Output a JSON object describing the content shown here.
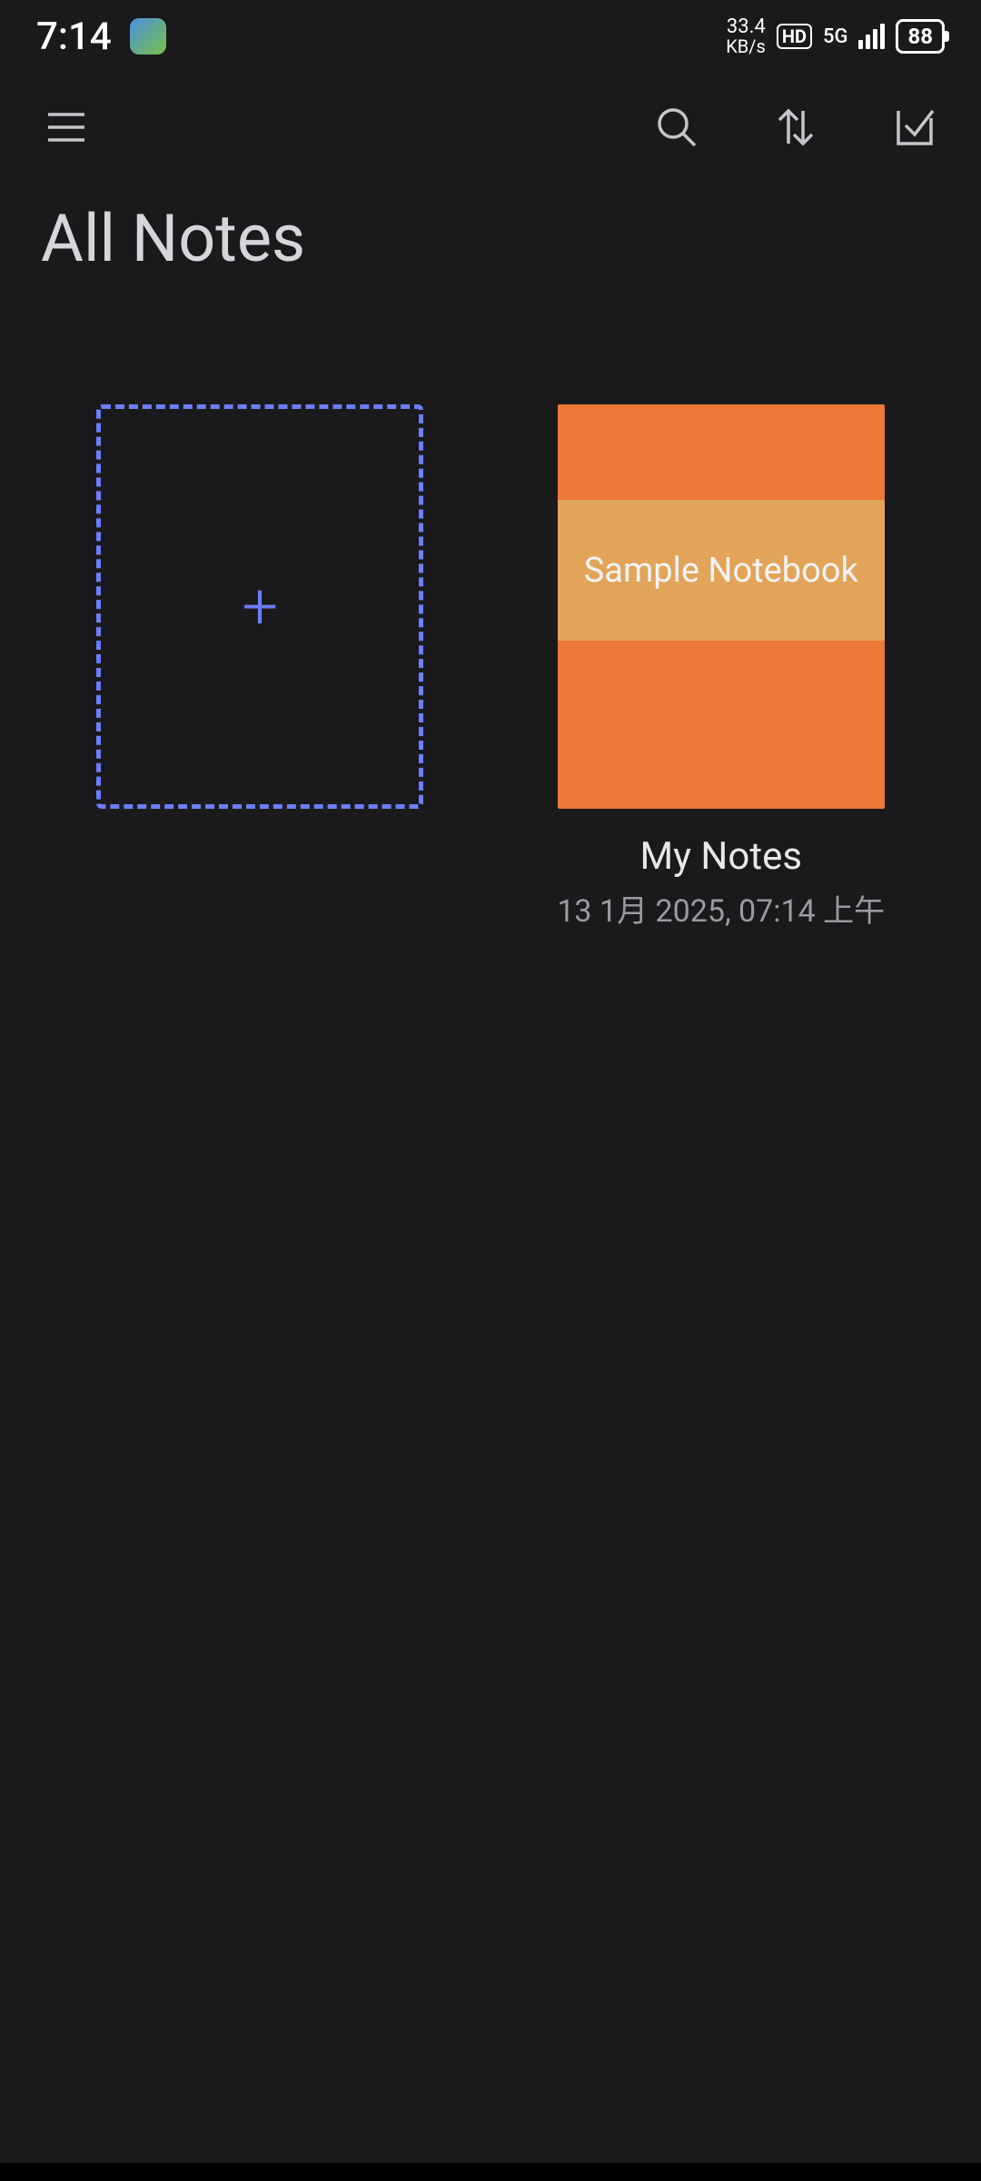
{
  "statusBar": {
    "time": "7:14",
    "speedValue": "33.4",
    "speedUnit": "KB/s",
    "hdBadge": "HD",
    "networkType": "5G",
    "batteryLevel": "88"
  },
  "page": {
    "title": "All Notes"
  },
  "addCard": {
    "plus": "+"
  },
  "notebooks": [
    {
      "coverTitle": "Sample Notebook",
      "title": "My Notes",
      "date": "13 1月 2025, 07:14 上午"
    }
  ]
}
